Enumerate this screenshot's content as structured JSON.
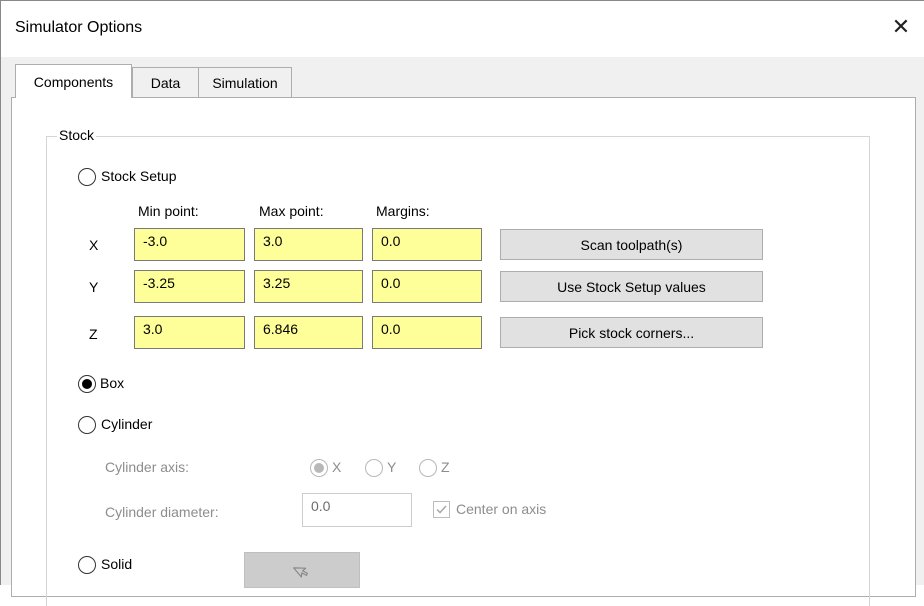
{
  "window": {
    "title": "Simulator Options",
    "close_label": "✕"
  },
  "tabs": [
    {
      "label": "Components",
      "active": true
    },
    {
      "label": "Data",
      "active": false
    },
    {
      "label": "Simulation",
      "active": false
    }
  ],
  "stock": {
    "group_label": "Stock",
    "stock_setup_label": "Stock Setup",
    "columns": {
      "min": "Min point:",
      "max": "Max point:",
      "margins": "Margins:"
    },
    "rows": [
      {
        "axis": "X",
        "min": "-3.0",
        "max": "3.0",
        "margin": "0.0",
        "button": "Scan toolpath(s)"
      },
      {
        "axis": "Y",
        "min": "-3.25",
        "max": "3.25",
        "margin": "0.0",
        "button": "Use Stock Setup values"
      },
      {
        "axis": "Z",
        "min": "3.0",
        "max": "6.846",
        "margin": "0.0",
        "button": "Pick stock corners..."
      }
    ],
    "box_label": "Box",
    "cylinder_label": "Cylinder",
    "cylinder_axis_label": "Cylinder axis:",
    "axis_options": [
      "X",
      "Y",
      "Z"
    ],
    "cylinder_diameter_label": "Cylinder diameter:",
    "cylinder_diameter_value": "0.0",
    "center_on_axis_label": "Center on axis",
    "solid_label": "Solid",
    "selected_shape": "Box"
  },
  "icons": {
    "close": "close-icon",
    "pick": "pointer-cursor-icon",
    "check": "checkmark-icon"
  },
  "colors": {
    "field_highlight": "#ffff99"
  }
}
